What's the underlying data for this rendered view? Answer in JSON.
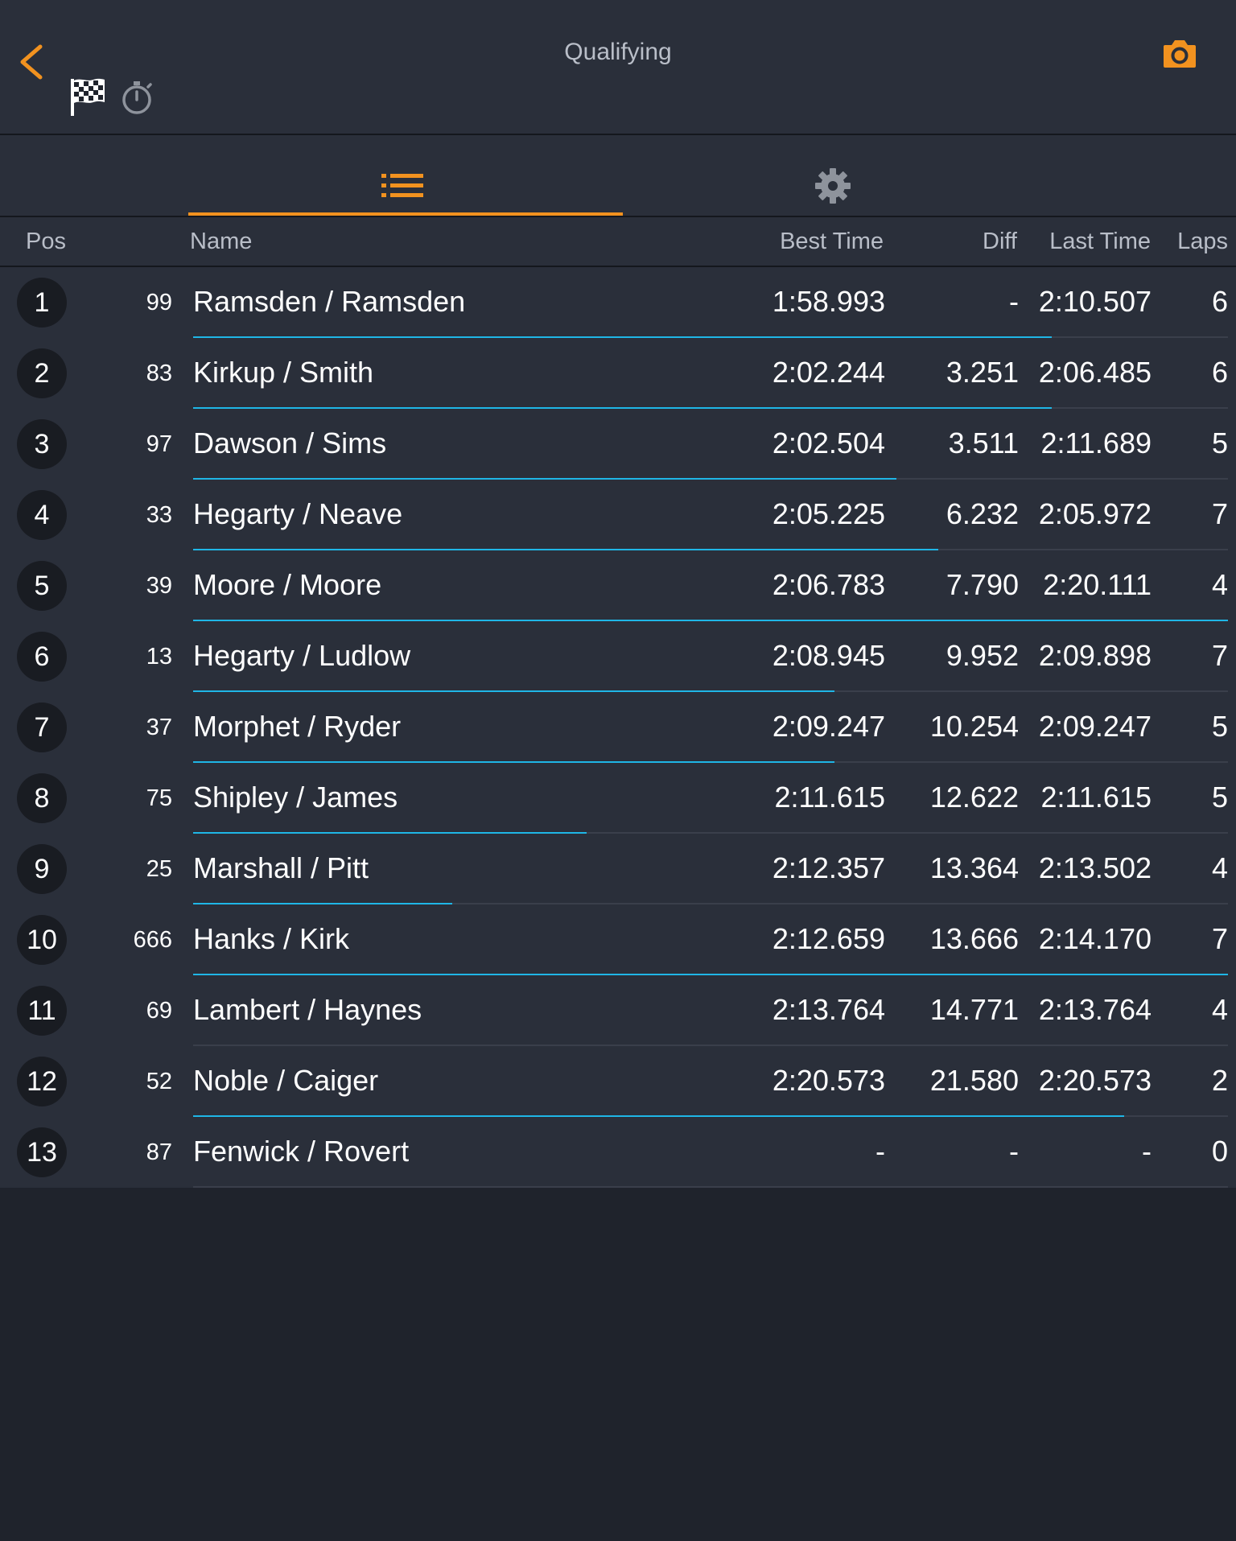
{
  "header": {
    "title": "Qualifying",
    "icons": {
      "back": "chevron-left-icon",
      "flag": "checkered-flag-icon",
      "timer": "stopwatch-icon",
      "camera": "camera-icon"
    },
    "accent_color": "#f2921f"
  },
  "tabs": [
    {
      "icon": "list-icon",
      "active": true
    },
    {
      "icon": "gear-icon",
      "active": false
    }
  ],
  "columns": {
    "pos": "Pos",
    "name": "Name",
    "best_time": "Best Time",
    "diff": "Diff",
    "last_time": "Last Time",
    "laps": "Laps"
  },
  "rows": [
    {
      "pos": "1",
      "number": "99",
      "name": "Ramsden / Ramsden",
      "best": "1:58.993",
      "diff": "-",
      "last": "2:10.507",
      "laps": "6",
      "progress": 0.83
    },
    {
      "pos": "2",
      "number": "83",
      "name": "Kirkup / Smith",
      "best": "2:02.244",
      "diff": "3.251",
      "last": "2:06.485",
      "laps": "6",
      "progress": 0.83
    },
    {
      "pos": "3",
      "number": "97",
      "name": "Dawson / Sims",
      "best": "2:02.504",
      "diff": "3.511",
      "last": "2:11.689",
      "laps": "5",
      "progress": 0.68
    },
    {
      "pos": "4",
      "number": "33",
      "name": "Hegarty / Neave",
      "best": "2:05.225",
      "diff": "6.232",
      "last": "2:05.972",
      "laps": "7",
      "progress": 0.72
    },
    {
      "pos": "5",
      "number": "39",
      "name": "Moore / Moore",
      "best": "2:06.783",
      "diff": "7.790",
      "last": "2:20.111",
      "laps": "4",
      "progress": 1.0
    },
    {
      "pos": "6",
      "number": "13",
      "name": "Hegarty / Ludlow",
      "best": "2:08.945",
      "diff": "9.952",
      "last": "2:09.898",
      "laps": "7",
      "progress": 0.62
    },
    {
      "pos": "7",
      "number": "37",
      "name": "Morphet / Ryder",
      "best": "2:09.247",
      "diff": "10.254",
      "last": "2:09.247",
      "laps": "5",
      "progress": 0.62
    },
    {
      "pos": "8",
      "number": "75",
      "name": "Shipley / James",
      "best": "2:11.615",
      "diff": "12.622",
      "last": "2:11.615",
      "laps": "5",
      "progress": 0.38
    },
    {
      "pos": "9",
      "number": "25",
      "name": "Marshall / Pitt",
      "best": "2:12.357",
      "diff": "13.364",
      "last": "2:13.502",
      "laps": "4",
      "progress": 0.25
    },
    {
      "pos": "10",
      "number": "666",
      "name": "Hanks / Kirk",
      "best": "2:12.659",
      "diff": "13.666",
      "last": "2:14.170",
      "laps": "7",
      "progress": 1.0
    },
    {
      "pos": "11",
      "number": "69",
      "name": "Lambert / Haynes",
      "best": "2:13.764",
      "diff": "14.771",
      "last": "2:13.764",
      "laps": "4",
      "progress": 0.0
    },
    {
      "pos": "12",
      "number": "52",
      "name": "Noble / Caiger",
      "best": "2:20.573",
      "diff": "21.580",
      "last": "2:20.573",
      "laps": "2",
      "progress": 0.9
    },
    {
      "pos": "13",
      "number": "87",
      "name": "Fenwick / Rovert",
      "best": "-",
      "diff": "-",
      "last": "-",
      "laps": "0",
      "progress": 0.0
    }
  ]
}
